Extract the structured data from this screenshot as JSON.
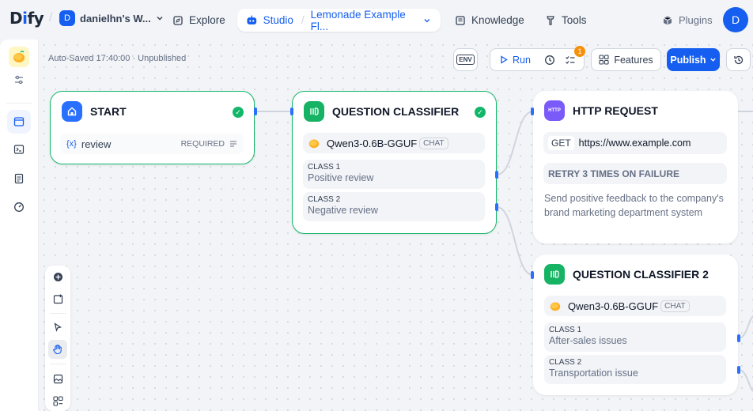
{
  "app": {
    "logo_d": "D",
    "logo_i": "i",
    "logo_fy": "fy"
  },
  "workspace": {
    "avatar": "D",
    "name": "danielhn's W..."
  },
  "nav": {
    "explore": "Explore",
    "studio": "Studio",
    "app_name": "Lemonade Example Fl...",
    "knowledge": "Knowledge",
    "tools": "Tools",
    "plugins": "Plugins",
    "user_avatar": "D"
  },
  "status": {
    "autosave": "Auto-Saved 17:40:00 · Unpublished"
  },
  "actions": {
    "env": "ENV",
    "run": "Run",
    "checklist_count": "1",
    "features": "Features",
    "publish": "Publish"
  },
  "nodes": {
    "start": {
      "title": "START",
      "var_icon": "{x}",
      "var_name": "review",
      "required": "REQUIRED"
    },
    "classifier": {
      "title": "QUESTION CLASSIFIER",
      "model": "Qwen3-0.6B-GGUF",
      "mode": "CHAT",
      "classes": [
        {
          "title": "CLASS 1",
          "text": "Positive review"
        },
        {
          "title": "CLASS 2",
          "text": "Negative review"
        }
      ]
    },
    "http": {
      "title": "HTTP REQUEST",
      "icon_text": "HTTP",
      "method": "GET",
      "url": "https://www.example.com",
      "retry": "RETRY 3 TIMES ON FAILURE",
      "desc": "Send positive feedback to the company's brand marketing department system"
    },
    "classifier2": {
      "title": "QUESTION CLASSIFIER 2",
      "model": "Qwen3-0.6B-GGUF",
      "mode": "CHAT",
      "classes": [
        {
          "title": "CLASS 1",
          "text": "After-sales issues"
        },
        {
          "title": "CLASS 2",
          "text": "Transportation issue"
        }
      ]
    }
  },
  "colors": {
    "accent": "#155eef",
    "success": "#12b76a",
    "warning": "#f79009",
    "edge": "#d0d5dd"
  }
}
